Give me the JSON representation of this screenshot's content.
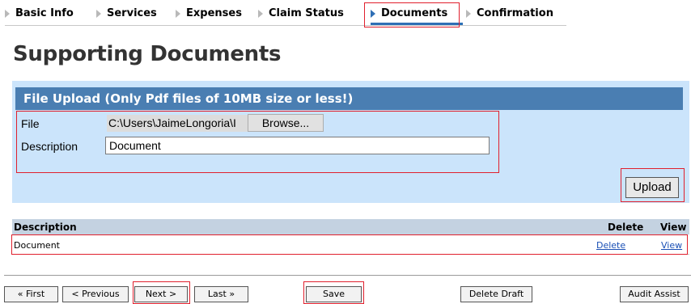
{
  "tabs": [
    {
      "label": "Basic Info",
      "active": false
    },
    {
      "label": "Services",
      "active": false
    },
    {
      "label": "Expenses",
      "active": false
    },
    {
      "label": "Claim Status",
      "active": false
    },
    {
      "label": "Documents",
      "active": true
    },
    {
      "label": "Confirmation",
      "active": false
    }
  ],
  "page": {
    "title": "Supporting Documents"
  },
  "upload": {
    "header": "File Upload (Only Pdf files of 10MB size or less!)",
    "file_label": "File",
    "file_value": "C:\\Users\\JaimeLongoria\\I",
    "browse_label": "Browse...",
    "description_label": "Description",
    "description_value": "Document",
    "upload_label": "Upload"
  },
  "documents_table": {
    "columns": [
      "Description",
      "Delete",
      "View"
    ],
    "rows": [
      {
        "description": "Document",
        "delete": "Delete",
        "view": "View"
      }
    ]
  },
  "footer_buttons": {
    "first": "« First",
    "previous": "< Previous",
    "next": "Next >",
    "last": "Last »",
    "save": "Save",
    "delete_draft": "Delete Draft",
    "audit_assist": "Audit Assist"
  },
  "colors": {
    "tab_active_accent": "#2f6fb5",
    "panel_background": "#cbe4fb",
    "panel_header": "#4a7eb2",
    "table_header": "#c4d2e1",
    "highlight_outline": "#e0202d",
    "link": "#1a4fb5"
  }
}
